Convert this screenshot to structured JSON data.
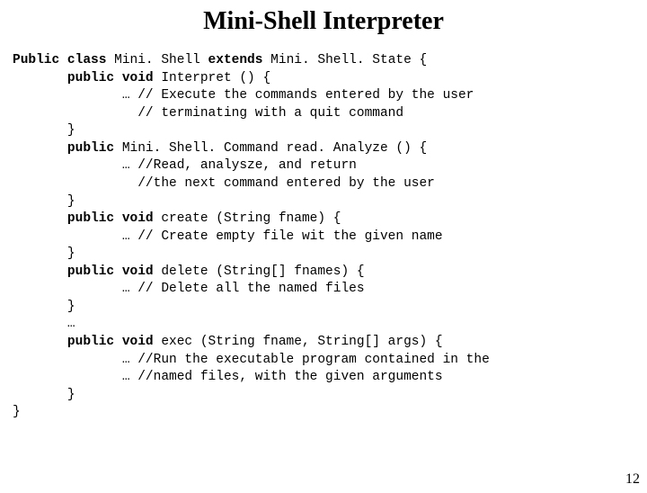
{
  "title": "Mini-Shell Interpreter",
  "pageNumber": "12",
  "code": {
    "l1a": "Public class ",
    "l1b": "Mini. Shell ",
    "l1c": "extends ",
    "l1d": "Mini. Shell. State {",
    "l2a": "       public void ",
    "l2b": "Interpret () {",
    "l3": "              … // Execute the commands entered by the user",
    "l4": "                // terminating with a quit command",
    "l5": "       }",
    "l6a": "       public ",
    "l6b": "Mini. Shell. Command read. Analyze () {",
    "l7": "              … //Read, analysze, and return",
    "l8": "                //the next command entered by the user",
    "l9": "       }",
    "l10a": "       public void ",
    "l10b": "create (String fname) {",
    "l11": "              … // Create empty file wit the given name",
    "l12": "       }",
    "l13a": "       public void ",
    "l13b": "delete (String[] fnames) {",
    "l14": "              … // Delete all the named files",
    "l15": "       }",
    "l16": "       …",
    "l17a": "       public void ",
    "l17b": "exec (String fname, String[] args) {",
    "l18": "              … //Run the executable program contained in the",
    "l19": "              … //named files, with the given arguments",
    "l20": "       }",
    "l21": "}"
  }
}
